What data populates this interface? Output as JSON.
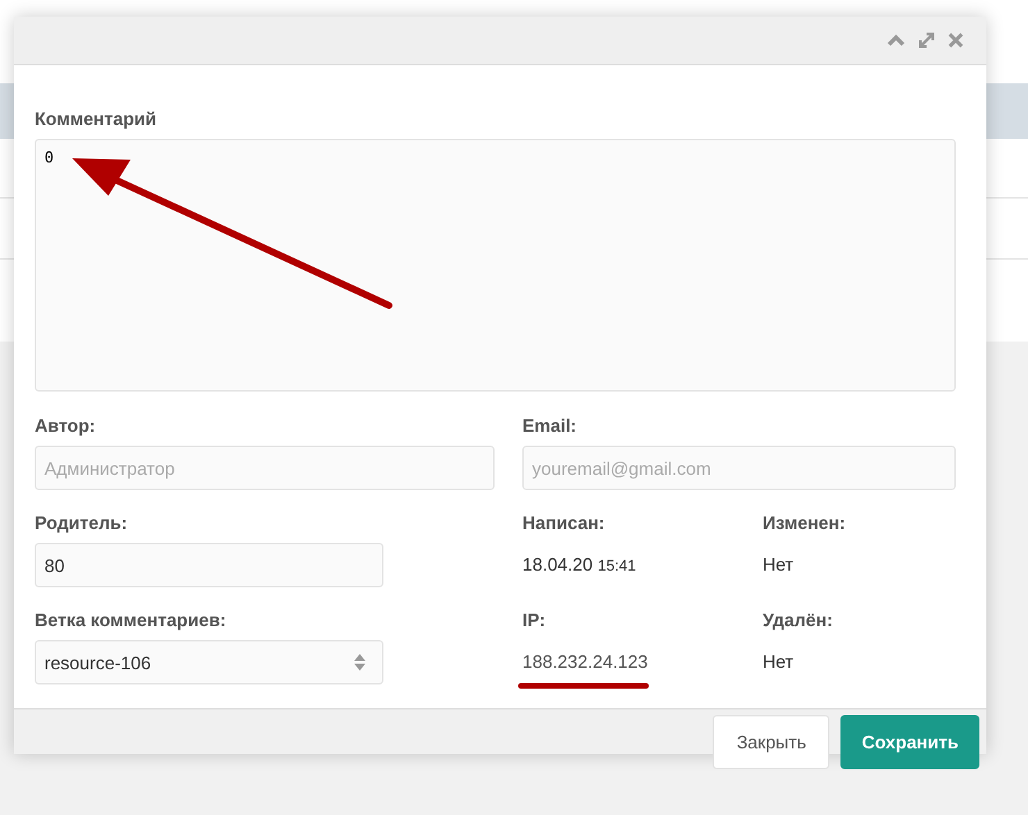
{
  "comment": {
    "label": "Комментарий",
    "value": "0"
  },
  "author": {
    "label": "Автор:",
    "placeholder": "Администратор"
  },
  "email": {
    "label": "Email:",
    "placeholder": "youremail@gmail.com"
  },
  "parent": {
    "label": "Родитель:",
    "value": "80"
  },
  "written": {
    "label": "Написан:",
    "date": "18.04.20",
    "time": "15:41"
  },
  "changed": {
    "label": "Изменен:",
    "value": "Нет"
  },
  "thread": {
    "label": "Ветка комментариев:",
    "value": "resource-106"
  },
  "ip": {
    "label": "IP:",
    "value": "188.232.24.123"
  },
  "deleted": {
    "label": "Удалён:",
    "value": "Нет"
  },
  "buttons": [
    {
      "label": "Закрыть",
      "kind": "default"
    },
    {
      "label": "Сохранить",
      "kind": "primary"
    }
  ]
}
